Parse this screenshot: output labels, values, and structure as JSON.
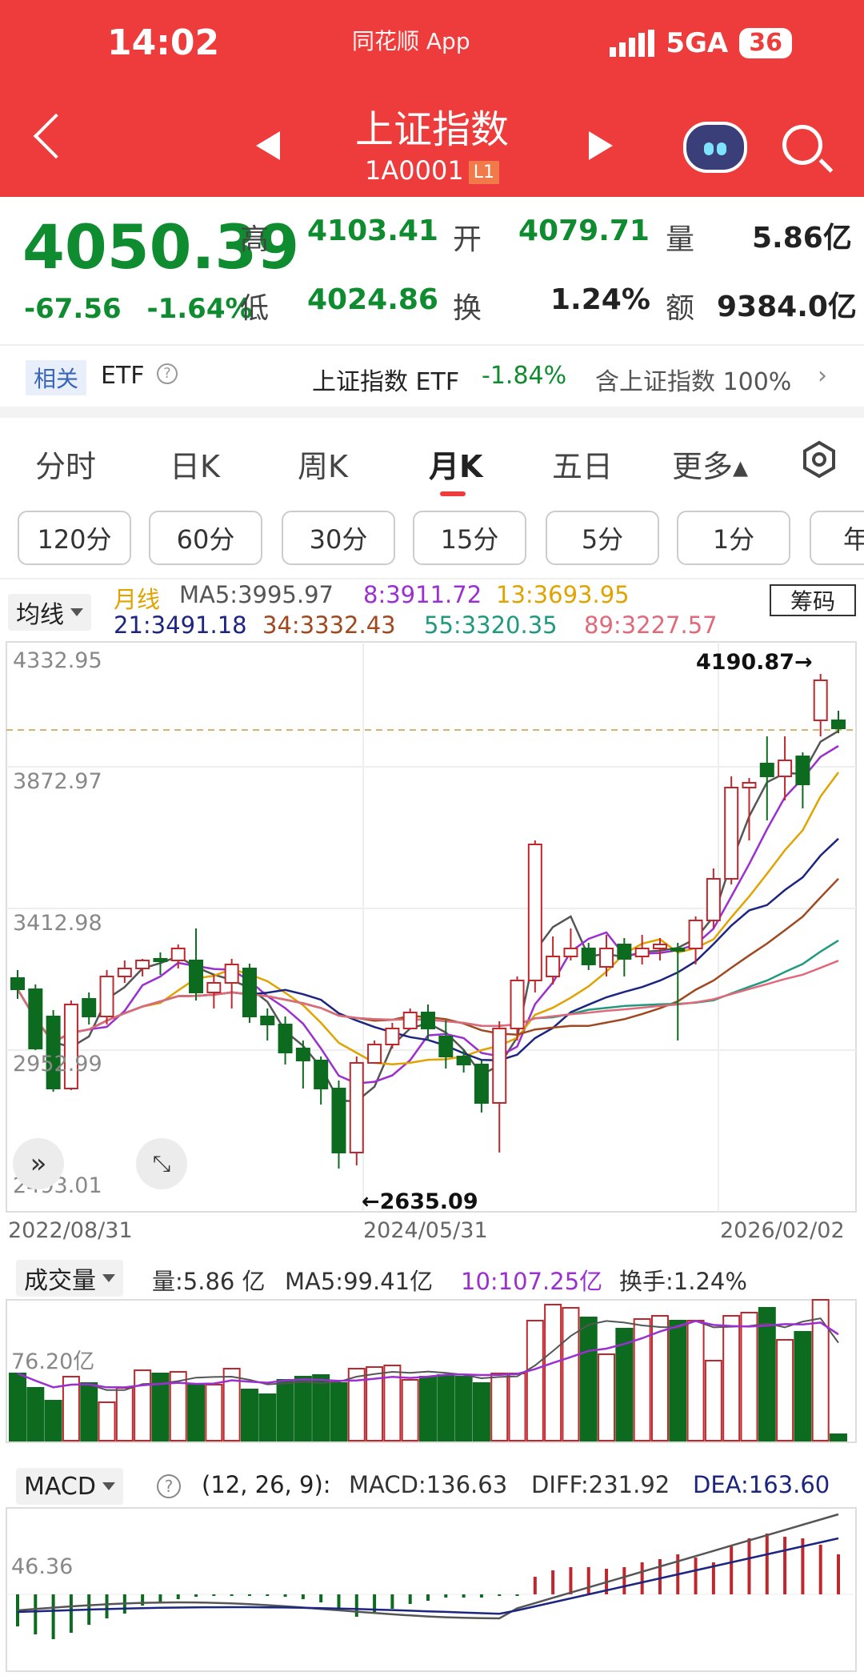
{
  "status": {
    "time": "14:02",
    "app": "同花顺 App",
    "network": "5GA",
    "battery": "36"
  },
  "header": {
    "title": "上证指数",
    "code": "1A0001",
    "level": "L1"
  },
  "quote": {
    "price": "4050.39",
    "change": "-67.56",
    "change_pct": "-1.64%",
    "high_label": "高",
    "high": "4103.41",
    "open_label": "开",
    "open": "4079.71",
    "volume_label": "量",
    "volume": "5.86亿",
    "low_label": "低",
    "low": "4024.86",
    "turnover_label": "换",
    "turnover": "1.24%",
    "amount_label": "额",
    "amount": "9384.0亿"
  },
  "etf": {
    "tag": "相关",
    "etf_label": "ETF",
    "name": "上证指数 ETF",
    "pct": "-1.84%",
    "holding": "含上证指数 100%"
  },
  "tabs": [
    "分时",
    "日K",
    "周K",
    "月K",
    "五日",
    "更多▴"
  ],
  "intervals": [
    "120分",
    "60分",
    "30分",
    "15分",
    "5分",
    "1分",
    "年"
  ],
  "ma": {
    "selector": "均线",
    "period": "月线",
    "ma5": "MA5:3995.97",
    "ma8": "8:3911.72",
    "ma13": "13:3693.95",
    "ma21": "21:3491.18",
    "ma34": "34:3332.43",
    "ma55": "55:3320.35",
    "ma89": "89:3227.57",
    "chips": "筹码"
  },
  "kline": {
    "y_labels": [
      "4332.95",
      "3872.97",
      "3412.98",
      "2952.99",
      "2493.01"
    ],
    "x_labels": [
      "2022/08/31",
      "2024/05/31",
      "2026/02/02"
    ],
    "max_note": "4190.87→",
    "min_note": "←2635.09",
    "colors": {
      "up": "#c0272d",
      "down": "#0c6b1e"
    }
  },
  "volume": {
    "selector": "成交量",
    "vol": "量:5.86 亿",
    "ma5": "MA5:99.41亿",
    "ma10": "10:107.25亿",
    "turnover": "换手:1.24%",
    "axis": "76.20亿"
  },
  "macd": {
    "selector": "MACD",
    "params": "(12, 26, 9):",
    "macd": "MACD:136.63",
    "diff": "DIFF:231.92",
    "dea": "DEA:163.60",
    "axis": "46.36"
  }
}
